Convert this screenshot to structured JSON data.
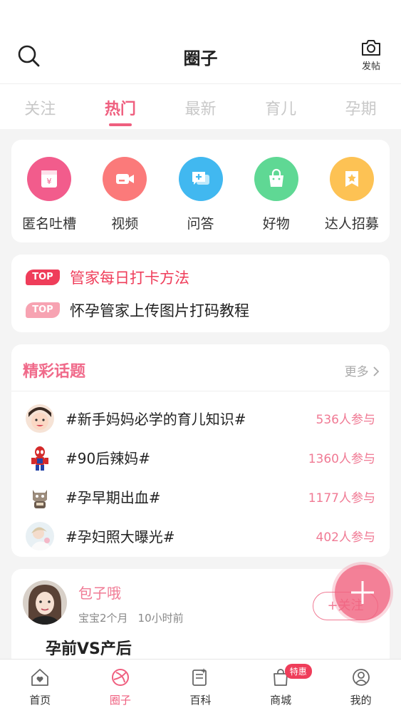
{
  "header": {
    "title": "圈子",
    "post_label": "发帖"
  },
  "tabs": [
    "关注",
    "热门",
    "最新",
    "育儿",
    "孕期"
  ],
  "active_tab": "热门",
  "categories": [
    {
      "label": "匿名吐槽",
      "icon": "anonymous-icon",
      "color": "#f25c8c"
    },
    {
      "label": "视频",
      "icon": "video-icon",
      "color": "#fb7a7a"
    },
    {
      "label": "问答",
      "icon": "qa-icon",
      "color": "#41b8f0"
    },
    {
      "label": "好物",
      "icon": "shopping-bag-icon",
      "color": "#5fd894"
    },
    {
      "label": "达人招募",
      "icon": "badge-icon",
      "color": "#fdc254"
    }
  ],
  "pinned": [
    {
      "tag": "TOP",
      "text": "管家每日打卡方法"
    },
    {
      "tag": "TOP",
      "text": "怀孕管家上传图片打码教程"
    }
  ],
  "topics": {
    "title": "精彩话题",
    "more": "更多",
    "items": [
      {
        "name": "#新手妈妈必学的育儿知识#",
        "count": "536人参与"
      },
      {
        "name": "#90后辣妈#",
        "count": "1360人参与"
      },
      {
        "name": "#孕早期出血#",
        "count": "1177人参与"
      },
      {
        "name": "#孕妇照大曝光#",
        "count": "402人参与"
      }
    ]
  },
  "post": {
    "author": "包子哦",
    "baby_age": "宝宝2个月",
    "time": "10小时前",
    "follow_label": "+关注",
    "title": "孕前VS产后"
  },
  "bottom_nav": {
    "items": [
      {
        "label": "首页",
        "icon": "home-icon"
      },
      {
        "label": "圈子",
        "icon": "circle-icon"
      },
      {
        "label": "百科",
        "icon": "encyclopedia-icon"
      },
      {
        "label": "商城",
        "icon": "shop-icon"
      },
      {
        "label": "我的",
        "icon": "profile-icon"
      }
    ],
    "shop_badge": "特惠"
  },
  "colors": {
    "accent": "#ef5f7f",
    "hot": "#ef3d5a"
  }
}
